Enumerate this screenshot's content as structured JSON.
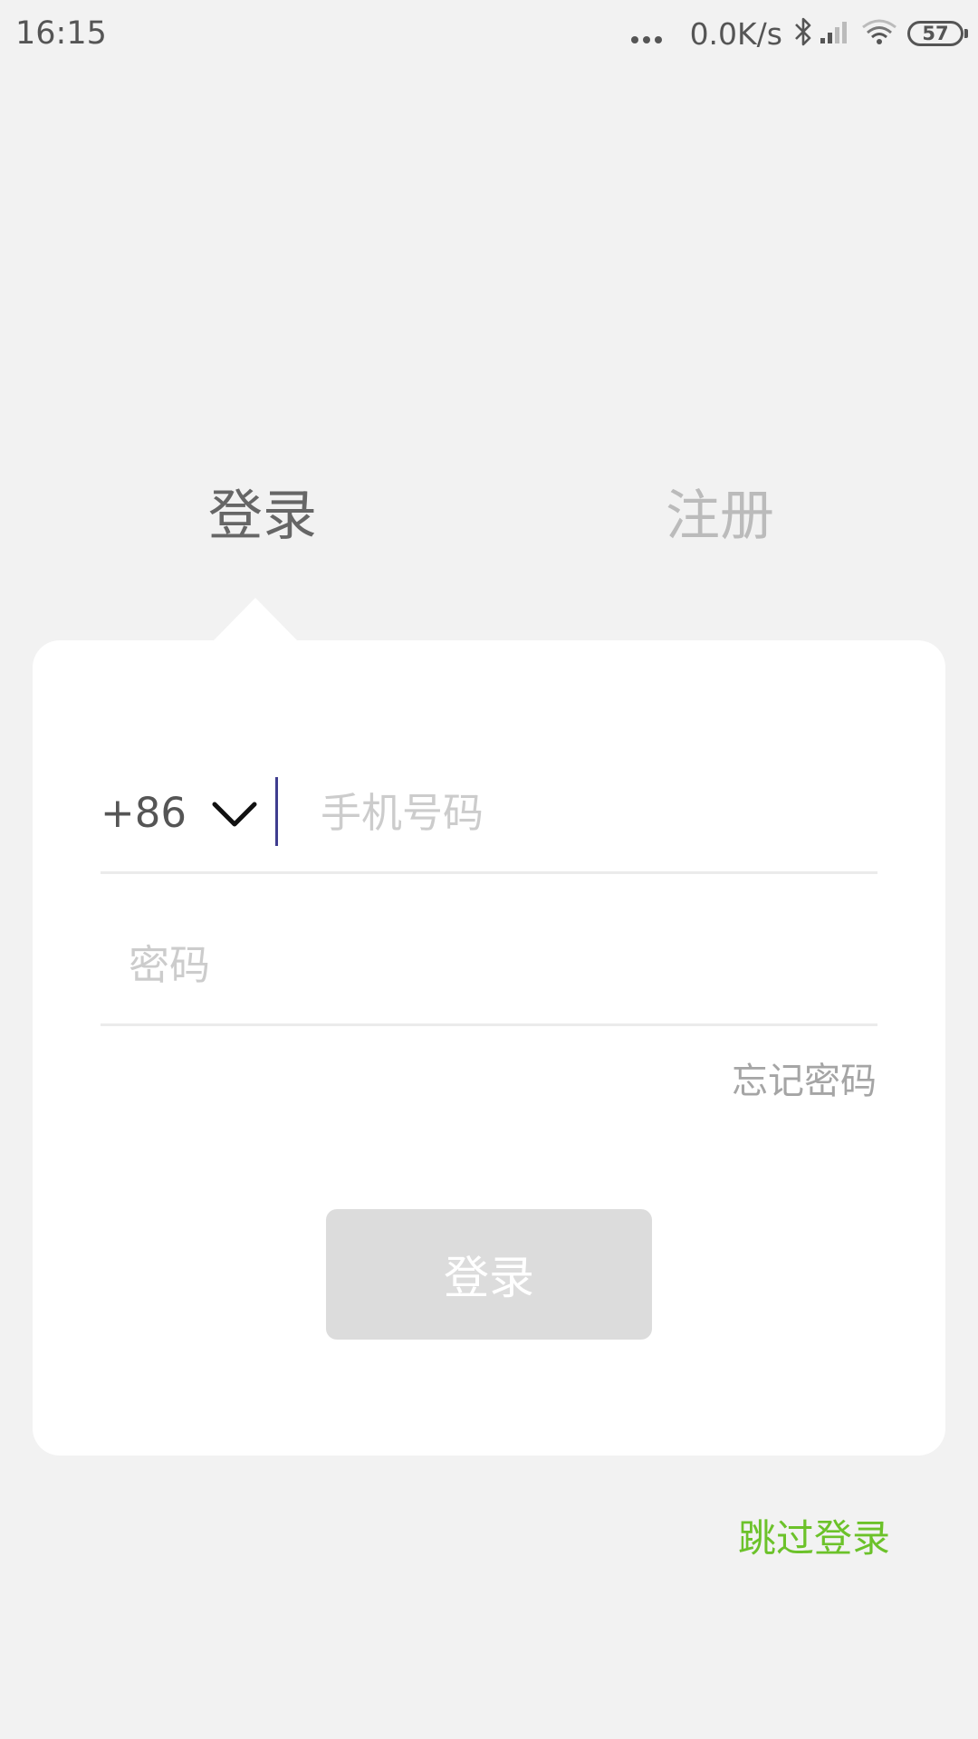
{
  "status_bar": {
    "time": "16:15",
    "net_speed": "0.0K/s",
    "battery": "57",
    "icons": [
      "more-dots-icon",
      "bluetooth-icon",
      "signal-icon",
      "wifi-icon",
      "battery-icon"
    ]
  },
  "tabs": [
    {
      "label": "登录",
      "active": true
    },
    {
      "label": "注册",
      "active": false
    }
  ],
  "form": {
    "country_code": "+86",
    "phone_placeholder": "手机号码",
    "password_placeholder": "密码",
    "forgot_password": "忘记密码",
    "login_button": "登录"
  },
  "skip_login": "跳过登录",
  "colors": {
    "background": "#f2f2f2",
    "card": "#ffffff",
    "active_tab": "#666666",
    "inactive_tab": "#bbbbbb",
    "button_disabled": "#dcdcdc",
    "skip_link": "#6cc22a",
    "caret": "#3f3d8f"
  }
}
